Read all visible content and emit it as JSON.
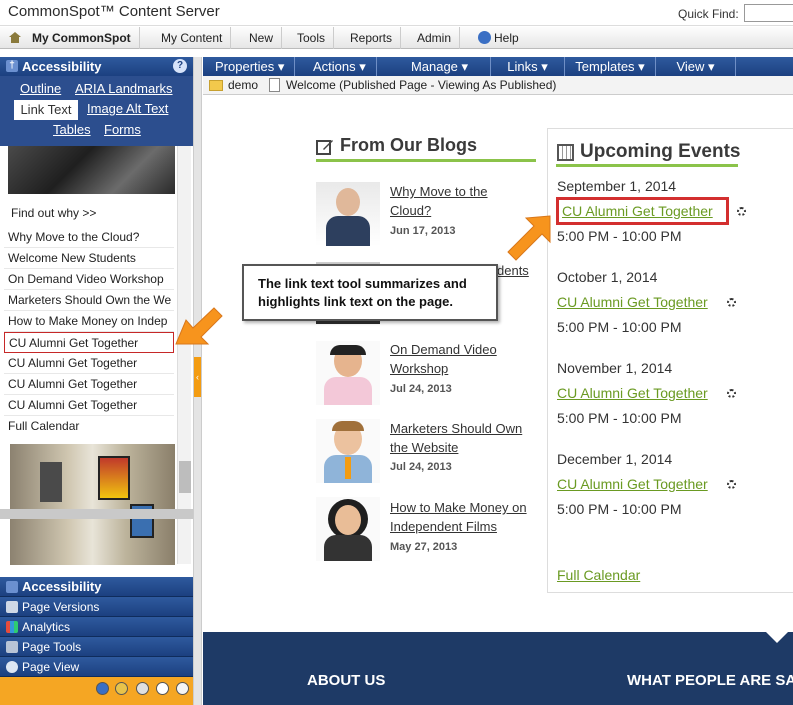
{
  "header": {
    "brand": "CommonSpot™ Content Server",
    "quick_find_label": "Quick Find:"
  },
  "menubar": {
    "items": [
      "My CommonSpot",
      "My Content",
      "New",
      "Tools",
      "Reports",
      "Admin",
      "Help"
    ]
  },
  "accessibility_panel": {
    "title": "Accessibility",
    "nav": {
      "outline": "Outline",
      "aria": "ARIA Landmarks",
      "link_text": "Link Text",
      "image_alt": "Image Alt Text",
      "tables": "Tables",
      "forms": "Forms"
    },
    "links": [
      "Find out why >>",
      "Why Move to the Cloud?",
      "Welcome New Students",
      "On Demand Video Workshop",
      "Marketers Should Own the We",
      "How to Make Money on Indep",
      "CU Alumni Get Together",
      "CU Alumni Get Together",
      "CU Alumni Get Together",
      "CU Alumni Get Together",
      "Full Calendar"
    ],
    "highlighted_index": 6
  },
  "bottom_accordion": [
    "Accessibility",
    "Page Versions",
    "Analytics",
    "Page Tools",
    "Page View"
  ],
  "toolbar": {
    "items": [
      "Properties ▾",
      "Actions ▾",
      "Manage ▾",
      "Links ▾",
      "Templates ▾",
      "View ▾"
    ]
  },
  "path": {
    "folder": "demo",
    "page": "Welcome (Published Page - Viewing As Published)"
  },
  "blogs": {
    "title": "From Our Blogs",
    "posts": [
      {
        "title_line1": "Why Move to the",
        "title_line2": "Cloud?",
        "date": "Jun 17, 2013"
      },
      {
        "title_line1": "Welcome New Students",
        "title_line2": "",
        "date": ""
      },
      {
        "title_line1": "On Demand Video",
        "title_line2": "Workshop",
        "date": "Jul 24, 2013"
      },
      {
        "title_line1": "Marketers Should Own",
        "title_line2": "the Website",
        "date": "Jul 24, 2013"
      },
      {
        "title_line1": "How to Make Money on",
        "title_line2": "Independent Films",
        "date": "May 27, 2013"
      }
    ],
    "partial_text": "dents"
  },
  "events": {
    "title": "Upcoming Events",
    "items": [
      {
        "date": "September 1, 2014",
        "link": "CU Alumni Get Together",
        "time": "5:00 PM - 10:00 PM"
      },
      {
        "date": "October 1, 2014",
        "link": "CU Alumni Get Together",
        "time": "5:00 PM - 10:00 PM"
      },
      {
        "date": "November 1, 2014",
        "link": "CU Alumni Get Together",
        "time": "5:00 PM - 10:00 PM"
      },
      {
        "date": "December 1, 2014",
        "link": "CU Alumni Get Together",
        "time": "5:00 PM - 10:00 PM"
      }
    ],
    "full_calendar": "Full Calendar"
  },
  "callout": {
    "text": "The link text tool summarizes and highlights link text on the page."
  },
  "footer": {
    "about": "ABOUT US",
    "people": "WHAT PEOPLE ARE SAY"
  },
  "colors": {
    "nav_blue": "#1c4080",
    "accent_green": "#8bc34a",
    "link_green": "#6a9a22",
    "highlight_red": "#d32f2f",
    "arrow_orange": "#f7941d",
    "footer_navy": "#1e3a66"
  }
}
